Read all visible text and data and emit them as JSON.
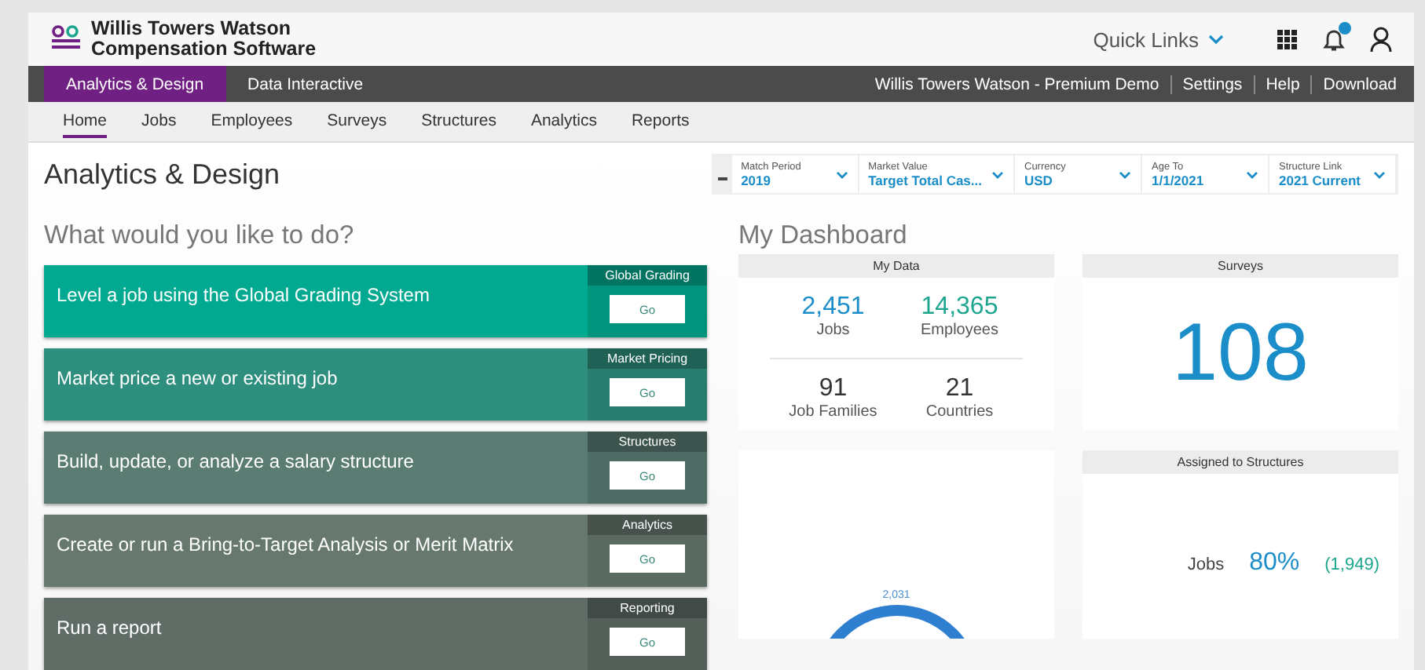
{
  "header": {
    "brand_line_1": "Willis Towers Watson",
    "brand_line_2": "Compensation Software",
    "quick_links": "Quick Links"
  },
  "nav_tabs": [
    {
      "label": "Analytics & Design",
      "selected": true
    },
    {
      "label": "Data Interactive",
      "selected": false
    }
  ],
  "nav_links": [
    "Willis Towers Watson - Premium Demo",
    "Settings",
    "Help",
    "Download"
  ],
  "sub_tabs": [
    {
      "label": "Home",
      "selected": true
    },
    {
      "label": "Jobs",
      "selected": false
    },
    {
      "label": "Employees",
      "selected": false
    },
    {
      "label": "Surveys",
      "selected": false
    },
    {
      "label": "Structures",
      "selected": false
    },
    {
      "label": "Analytics",
      "selected": false
    },
    {
      "label": "Reports",
      "selected": false
    }
  ],
  "page_title": "Analytics & Design",
  "filters": [
    {
      "label": "Match Period",
      "value": "2019"
    },
    {
      "label": "Market Value",
      "value": "Target Total Cas..."
    },
    {
      "label": "Currency",
      "value": "USD"
    },
    {
      "label": "Age To",
      "value": "1/1/2021"
    },
    {
      "label": "Structure Link",
      "value": "2021 Current"
    }
  ],
  "actions_title": "What would you like to do?",
  "actions": [
    {
      "text": "Level a job using the Global Grading System",
      "tag": "Global Grading",
      "button": "Go",
      "color": "#00a98f"
    },
    {
      "text": "Market price a new or existing job",
      "tag": "Market Pricing",
      "button": "Go",
      "color": "#2f8f7e"
    },
    {
      "text": "Build, update, or analyze a salary structure",
      "tag": "Structures",
      "button": "Go",
      "color": "#5b7c72"
    },
    {
      "text": "Create or run a Bring-to-Target Analysis or Merit Matrix",
      "tag": "Analytics",
      "button": "Go",
      "color": "#67796f"
    },
    {
      "text": "Run a report",
      "tag": "Reporting",
      "button": "Go",
      "color": "#606d67"
    }
  ],
  "dashboard": {
    "title": "My Dashboard",
    "my_data": {
      "title": "My Data",
      "stats": [
        {
          "value": "2,451",
          "label": "Jobs",
          "kind": "primary"
        },
        {
          "value": "14,365",
          "label": "Employees",
          "kind": "secondary"
        },
        {
          "value": "91",
          "label": "Job Families",
          "kind": "plain"
        },
        {
          "value": "21",
          "label": "Countries",
          "kind": "plain"
        }
      ]
    },
    "surveys": {
      "title": "Surveys",
      "value": "108"
    },
    "gauge": {
      "label": "2,031"
    },
    "assigned": {
      "title": "Assigned to Structures",
      "label": "Jobs",
      "percent": "80%",
      "count": "(1,949)"
    }
  }
}
